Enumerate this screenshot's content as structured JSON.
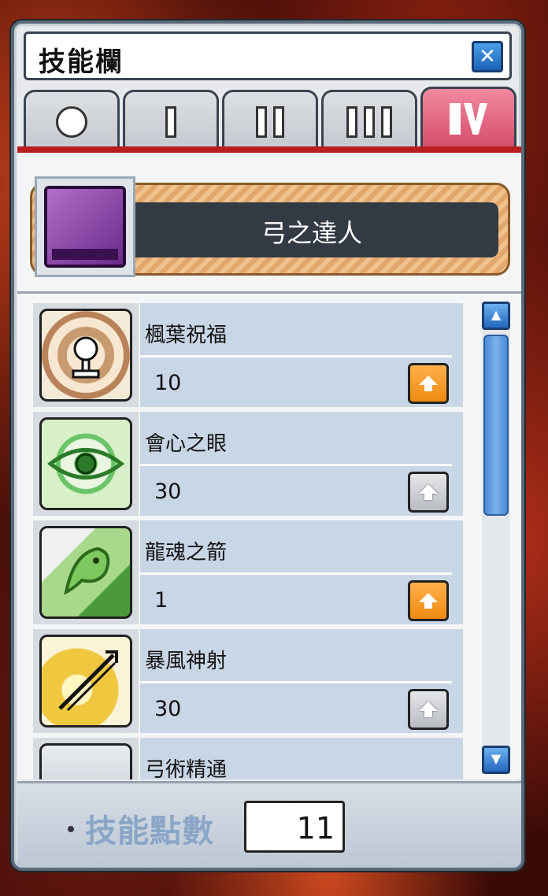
{
  "window": {
    "title": "技能欄",
    "close_icon": "close-icon"
  },
  "tabs": [
    {
      "label": "0",
      "glyph": "circle",
      "active": false
    },
    {
      "label": "I",
      "glyph": "bars-1",
      "active": false
    },
    {
      "label": "II",
      "glyph": "bars-2",
      "active": false
    },
    {
      "label": "III",
      "glyph": "bars-3",
      "active": false
    },
    {
      "label": "IV",
      "glyph": "roman-iv",
      "active": true
    }
  ],
  "job": {
    "name": "弓之達人",
    "icon": "purple-skill-book-icon"
  },
  "skills": [
    {
      "name": "楓葉祝福",
      "level": "10",
      "icon": "maple-blessing-icon",
      "can_level_up": true
    },
    {
      "name": "會心之眼",
      "level": "30",
      "icon": "sharp-eyes-icon",
      "can_level_up": false
    },
    {
      "name": "龍魂之箭",
      "level": "1",
      "icon": "dragon-soul-arrow-icon",
      "can_level_up": true
    },
    {
      "name": "暴風神射",
      "level": "30",
      "icon": "hurricane-icon",
      "can_level_up": false
    },
    {
      "name": "弓術精通",
      "level": "",
      "icon": "bow-expert-icon",
      "can_level_up": false
    }
  ],
  "footer": {
    "skill_points_label": "技能點數",
    "skill_points_value": "11"
  },
  "colors": {
    "active_tab": "#d44a68",
    "level_up": "#ee8a10",
    "accent_line": "#b81e1e"
  }
}
